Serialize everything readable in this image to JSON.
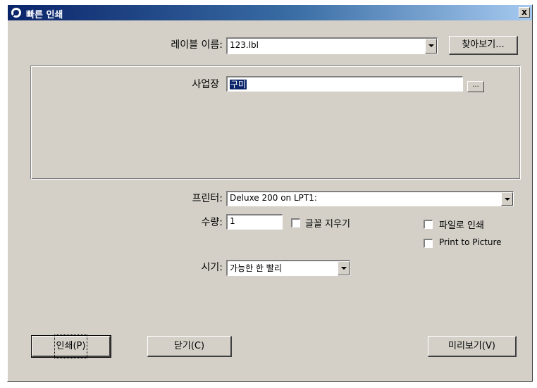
{
  "window": {
    "title": "빠른 인쇄",
    "close_glyph": "x"
  },
  "form": {
    "label_name": {
      "label": "레이블 이름:",
      "value": "123.lbl"
    },
    "browse_button": "찾아보기...",
    "site": {
      "label": "사업장",
      "value": "구미"
    },
    "site_browse_button": "...",
    "printer": {
      "label": "프린터:",
      "value": "Deluxe 200 on LPT1:"
    },
    "quantity": {
      "label": "수량:",
      "value": "1"
    },
    "clear_font_check": {
      "label": "글꼴 지우기",
      "checked": false
    },
    "print_to_file_check": {
      "label": "파일로 인쇄",
      "checked": false
    },
    "print_to_picture_check": {
      "label": "Print to Picture",
      "checked": false
    },
    "timing": {
      "label": "시기:",
      "value": "가능한 한 빨리"
    }
  },
  "buttons": {
    "print": "인쇄(P)",
    "close": "닫기(C)",
    "preview": "미리보기(V)"
  },
  "colors": {
    "dialog_bg": "#d4d0c8",
    "titlebar_start": "#0a246a",
    "titlebar_end": "#a6caf0",
    "selection": "#0a246a"
  }
}
